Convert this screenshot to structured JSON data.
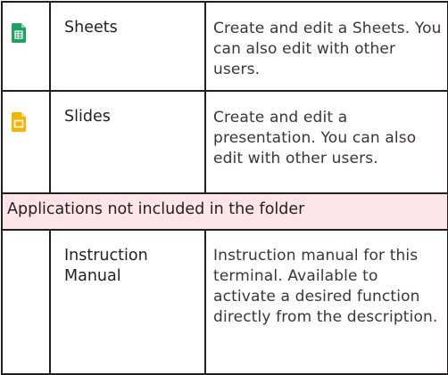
{
  "rows": [
    {
      "icon": "google-sheets-icon",
      "name": "Sheets",
      "description": "Create and edit a Sheets. You can also edit with other users."
    },
    {
      "icon": "google-slides-icon",
      "name": "Slides",
      "description": "Create and edit a presentation. You can also edit with other users."
    }
  ],
  "section": {
    "label": "Applications not included in the folder",
    "background": "#fde4e8"
  },
  "rows_after_section": [
    {
      "name": "Instruction Manual",
      "description": "Instruction manual for this terminal. Available to activate a desired function directly from the description."
    }
  ],
  "colors": {
    "sheets_green": "#1ea362",
    "slides_yellow": "#f4b400",
    "border": "#231f20"
  }
}
